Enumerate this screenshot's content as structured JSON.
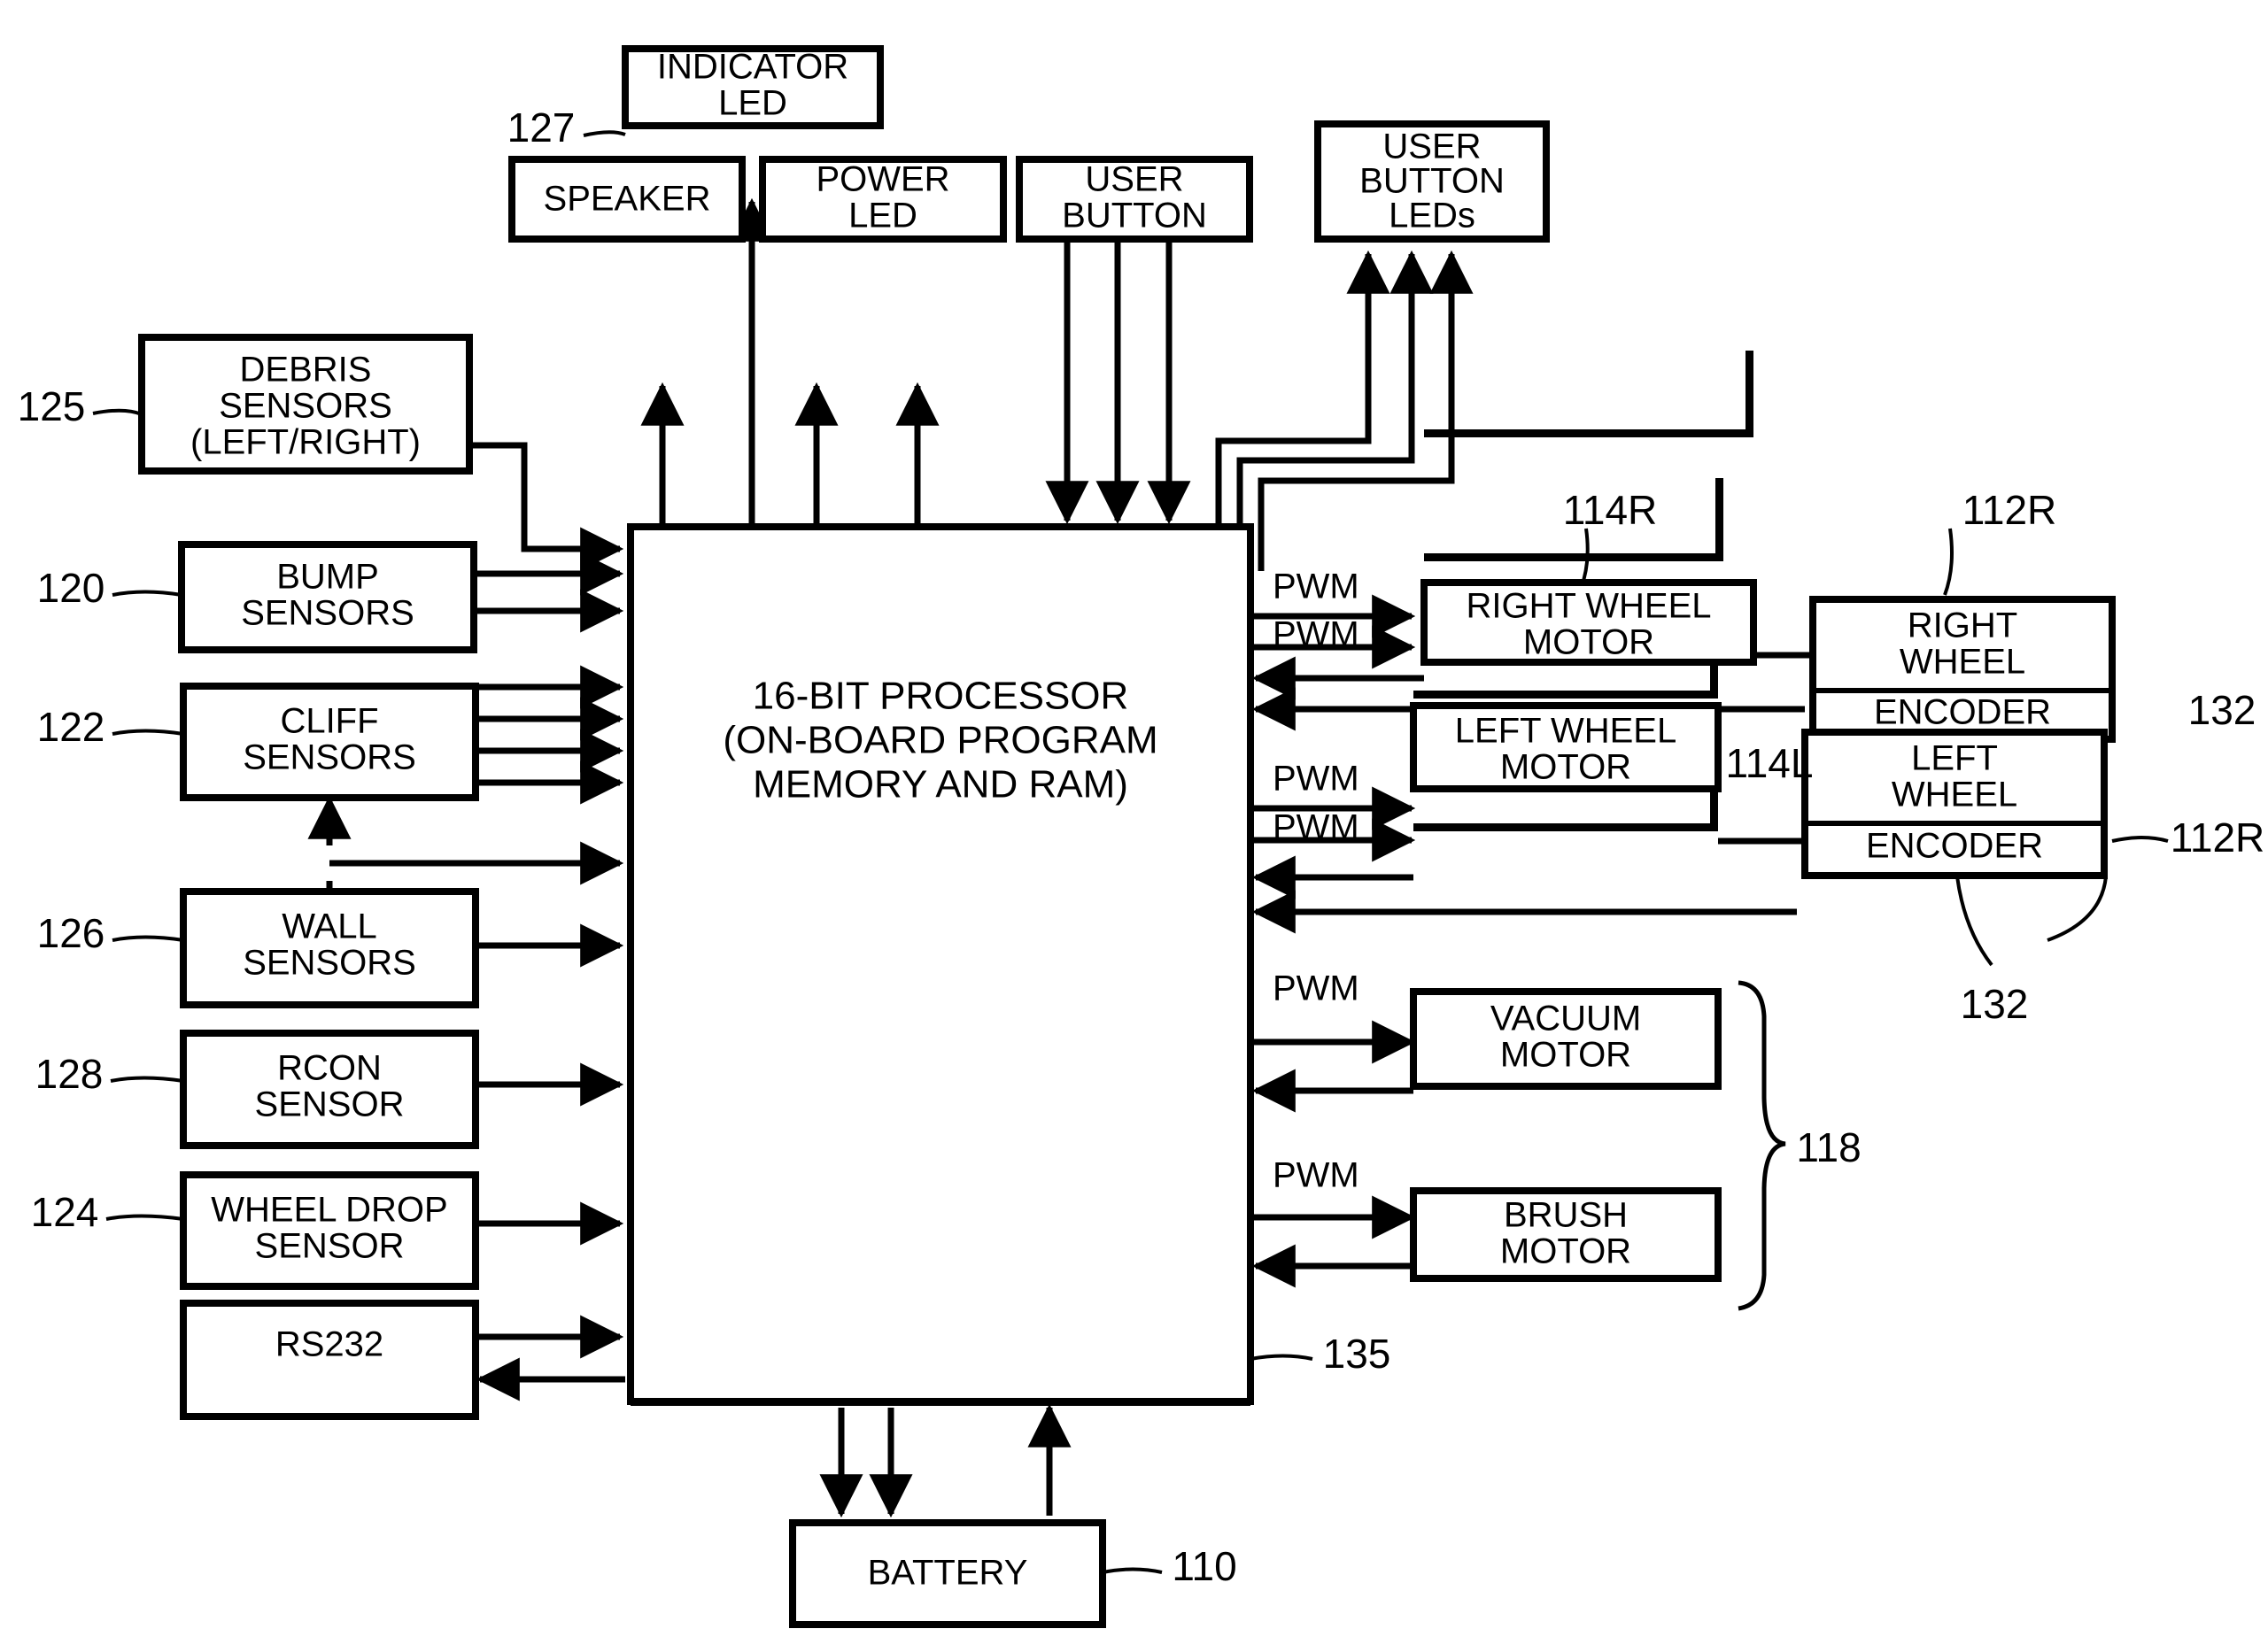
{
  "diagram": {
    "title": "Robot control system block diagram",
    "line_color": "#000000",
    "background": "#ffffff"
  },
  "blocks": {
    "indicator_led": {
      "lines": [
        "INDICATOR",
        "LED"
      ]
    },
    "speaker": {
      "lines": [
        "SPEAKER"
      ]
    },
    "power_led": {
      "lines": [
        "POWER",
        "LED"
      ]
    },
    "user_button": {
      "lines": [
        "USER",
        "BUTTON"
      ]
    },
    "user_button_leds": {
      "lines": [
        "USER",
        "BUTTON",
        "LEDs"
      ]
    },
    "debris_sensors": {
      "lines": [
        "DEBRIS",
        "SENSORS",
        "(LEFT/RIGHT)"
      ]
    },
    "bump_sensors": {
      "lines": [
        "BUMP",
        "SENSORS"
      ]
    },
    "cliff_sensors": {
      "lines": [
        "CLIFF",
        "SENSORS"
      ]
    },
    "wall_sensors": {
      "lines": [
        "WALL",
        "SENSORS"
      ]
    },
    "rcon_sensor": {
      "lines": [
        "RCON",
        "SENSOR"
      ]
    },
    "wheel_drop_sensor": {
      "lines": [
        "WHEEL DROP",
        "SENSOR"
      ]
    },
    "rs232": {
      "lines": [
        "RS232"
      ]
    },
    "processor": {
      "lines": [
        "16-BIT PROCESSOR",
        "(ON-BOARD PROGRAM",
        "MEMORY AND RAM)"
      ]
    },
    "right_wheel_motor": {
      "lines": [
        "RIGHT WHEEL",
        "MOTOR"
      ]
    },
    "left_wheel_motor": {
      "lines": [
        "LEFT WHEEL",
        "MOTOR"
      ]
    },
    "right_wheel": {
      "lines": [
        "RIGHT",
        "WHEEL"
      ]
    },
    "right_wheel_encoder": {
      "lines": [
        "ENCODER"
      ]
    },
    "left_wheel": {
      "lines": [
        "LEFT",
        "WHEEL"
      ]
    },
    "left_wheel_encoder": {
      "lines": [
        "ENCODER"
      ]
    },
    "vacuum_motor": {
      "lines": [
        "VACUUM",
        "MOTOR"
      ]
    },
    "brush_motor": {
      "lines": [
        "BRUSH",
        "MOTOR"
      ]
    },
    "battery": {
      "lines": [
        "BATTERY"
      ]
    }
  },
  "reference_numerals": {
    "indicator_led": "127",
    "debris_sensors": "125",
    "bump_sensors": "120",
    "cliff_sensors": "122",
    "wall_sensors": "126",
    "rcon_sensor": "128",
    "wheel_drop_sensor": "124",
    "right_wheel_motor": "114R",
    "left_wheel_motor": "114L",
    "right_wheel": "112R",
    "right_wheel_encoder": "132",
    "left_wheel": "112R",
    "left_wheel_encoder": "132",
    "cleaning_motors_brace": "118",
    "processor": "135",
    "battery": "110"
  },
  "signal_labels": {
    "pwm_right_1": "PWM",
    "pwm_right_2": "PWM",
    "pwm_left_1": "PWM",
    "pwm_left_2": "PWM",
    "pwm_vacuum": "PWM",
    "pwm_brush": "PWM"
  }
}
